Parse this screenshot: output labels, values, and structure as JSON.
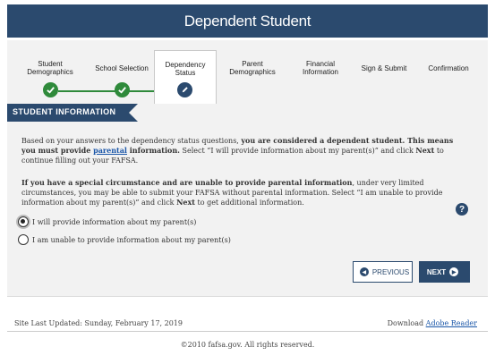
{
  "header": {
    "title": "Dependent Student"
  },
  "steps": [
    {
      "label": "Student Demographics",
      "status": "done"
    },
    {
      "label": "School Selection",
      "status": "done"
    },
    {
      "label": "Dependency Status",
      "status": "current"
    },
    {
      "label": "Parent Demographics",
      "status": "pending"
    },
    {
      "label": "Financial Information",
      "status": "pending"
    },
    {
      "label": "Sign & Submit",
      "status": "pending"
    },
    {
      "label": "Confirmation",
      "status": "pending"
    }
  ],
  "section": {
    "banner": "STUDENT INFORMATION"
  },
  "paragraph1": {
    "part1": "Based on your answers to the dependency status questions, ",
    "bold1": "you are considered a dependent student. This means you must provide ",
    "link": "parental",
    "bold2": " information.",
    "part2": " Select “I will provide information about my parent(s)” and click ",
    "next_word": "Next",
    "part3": " to continue filling out your FAFSA."
  },
  "paragraph2": {
    "bold1": "If you have a special circumstance and are unable to provide parental information",
    "part1": ", under very limited circumstances, you may be able to submit your FAFSA without parental information. Select “I am unable to provide information about my parent(s)” and click ",
    "next_word": "Next",
    "part2": " to get additional information."
  },
  "help": {
    "symbol": "?"
  },
  "options": [
    {
      "label": "I will provide information about my parent(s)",
      "checked": true
    },
    {
      "label": "I am unable to provide information about my parent(s)",
      "checked": false
    }
  ],
  "buttons": {
    "previous": "PREVIOUS",
    "next": "NEXT"
  },
  "footer": {
    "updated": "Site Last Updated: Sunday, February 17, 2019",
    "download_prefix": "Download ",
    "download_link": "Adobe Reader",
    "copyright": "©2010 fafsa.gov. All rights reserved."
  },
  "colors": {
    "navy": "#2b4a6e",
    "green": "#2f8a3b",
    "panel": "#f2f2f2",
    "link": "#1a56a8"
  }
}
